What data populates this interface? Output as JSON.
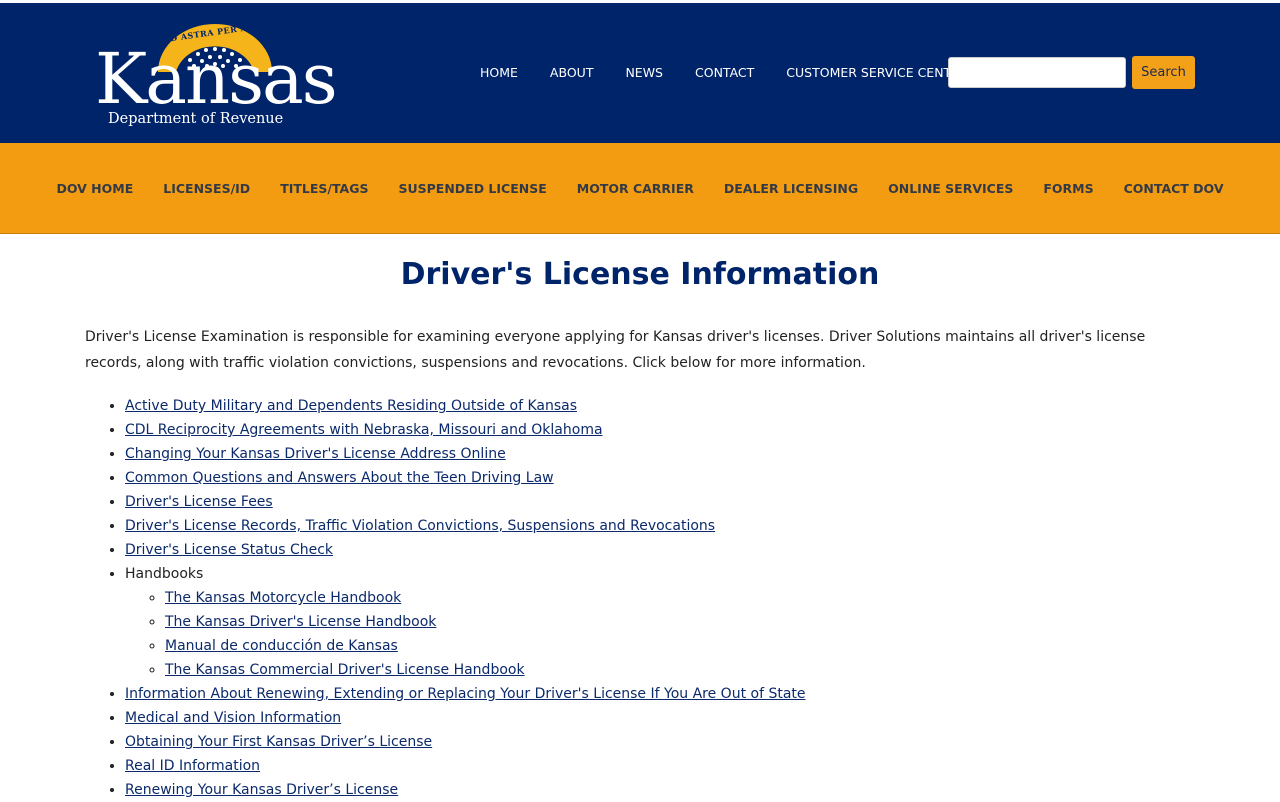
{
  "header": {
    "logo": {
      "word": "Kansas",
      "motto": "AD ASTRA PER ASPERA",
      "subtitle": "Department of Revenue"
    },
    "top_nav": [
      {
        "label": "HOME"
      },
      {
        "label": "ABOUT"
      },
      {
        "label": "NEWS"
      },
      {
        "label": "CONTACT"
      },
      {
        "label": "CUSTOMER SERVICE CENTER"
      }
    ],
    "search": {
      "value": "",
      "button_label": "Search"
    }
  },
  "main_nav": [
    {
      "label": "DOV HOME"
    },
    {
      "label": "LICENSES/ID"
    },
    {
      "label": "TITLES/TAGS"
    },
    {
      "label": "SUSPENDED LICENSE"
    },
    {
      "label": "MOTOR CARRIER"
    },
    {
      "label": "DEALER LICENSING"
    },
    {
      "label": "ONLINE SERVICES"
    },
    {
      "label": "FORMS"
    },
    {
      "label": "CONTACT DOV"
    }
  ],
  "page": {
    "title": "Driver's License Information",
    "intro": "Driver's License Examination is responsible for examining everyone applying for Kansas driver's licenses. Driver Solutions maintains all driver's license records, along with traffic violation convictions, suspensions and revocations. Click below for more information.",
    "links": [
      {
        "label": "Active Duty Military and Dependents Residing Outside of Kansas"
      },
      {
        "label": "CDL Reciprocity Agreements with Nebraska, Missouri and Oklahoma"
      },
      {
        "label": "Changing Your Kansas Driver's License Address Online"
      },
      {
        "label": "Common Questions and Answers About the Teen Driving Law"
      },
      {
        "label": "Driver's License Fees"
      },
      {
        "label": "Driver's License Records, Traffic Violation Convictions, Suspensions and Revocations"
      },
      {
        "label": "Driver's License Status Check"
      }
    ],
    "handbooks": {
      "label": "Handbooks",
      "items": [
        {
          "label": "The Kansas Motorcycle Handbook"
        },
        {
          "label": "The Kansas Driver's License Handbook"
        },
        {
          "label": "Manual de conducción de Kansas"
        },
        {
          "label": "The Kansas Commercial Driver's License Handbook"
        }
      ]
    },
    "links_after": [
      {
        "label": "Information About Renewing, Extending or Replacing Your Driver's License If You Are Out of State"
      },
      {
        "label": "Medical and Vision Information"
      },
      {
        "label": "Obtaining Your First Kansas Driver’s License"
      },
      {
        "label": "Real ID Information"
      },
      {
        "label": "Renewing Your Kansas Driver’s License"
      }
    ]
  },
  "colors": {
    "navy": "#002469",
    "gold": "#f39c12",
    "link": "#0b2a6b"
  }
}
